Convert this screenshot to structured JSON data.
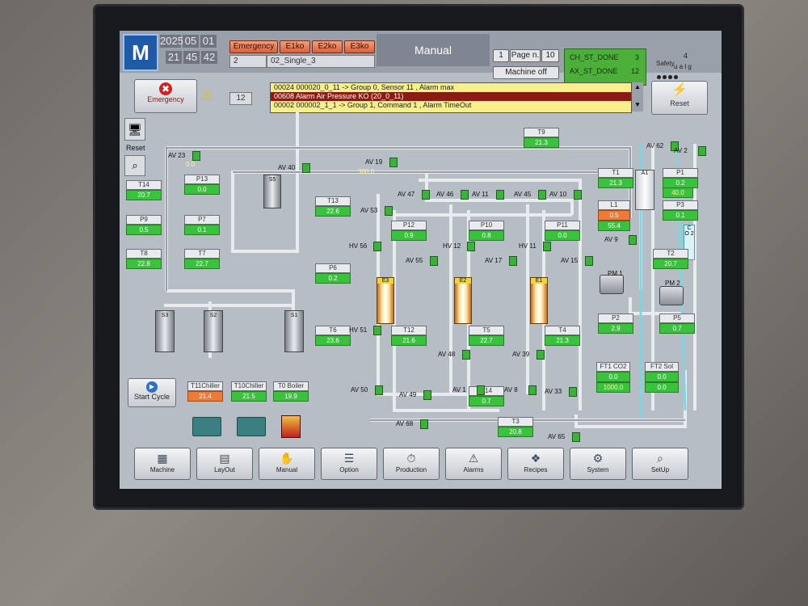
{
  "header": {
    "logo_text": "M",
    "date": [
      "2025",
      "05",
      "01"
    ],
    "time": [
      "21",
      "45",
      "42"
    ],
    "emergency_buttons": [
      "Emergency",
      "E1ko",
      "E2ko",
      "E3ko"
    ],
    "mode_num": "2",
    "recipe": "02_Single_3",
    "mode": "Manual",
    "page_label": "Page n.",
    "page_current": "1",
    "page_total": "10",
    "machine_state": "Machine off",
    "status_lines": [
      {
        "text": "CH_ST_DONE",
        "value": "3"
      },
      {
        "text": "AX_ST_DONE",
        "value": "12"
      }
    ],
    "safety_label": "Safety",
    "safety_count": "4",
    "safety_text": "u a l g"
  },
  "alarm_bar": {
    "emergency_label": "Emergency",
    "warning_count": "12",
    "reset_label": "Reset",
    "alarms": [
      {
        "text": "00024  000020_0_11 -> Group 0, Sensor 11 , Alarm max",
        "color": "#f6ef8a"
      },
      {
        "text": "00608  Alarm Air Pressure KO  (20_0_11)",
        "color": "#8a1c14"
      },
      {
        "text": "00002  000002_1_1 -> Group 1, Command 1 , Alarm TimeOut",
        "color": "#f6ef8a"
      }
    ]
  },
  "left_tools": {
    "reset_label": "Reset"
  },
  "tags": [
    {
      "id": "T9",
      "value": "21.3"
    },
    {
      "id": "T14",
      "value": "20.7"
    },
    {
      "id": "P13",
      "value": "0.0"
    },
    {
      "id": "P9",
      "value": "0.5"
    },
    {
      "id": "P7",
      "value": "0.1"
    },
    {
      "id": "T8",
      "value": "22.8"
    },
    {
      "id": "T7",
      "value": "22.7"
    },
    {
      "id": "T13",
      "value": "22.6"
    },
    {
      "id": "P6",
      "value": "0.2"
    },
    {
      "id": "T6",
      "value": "23.6"
    },
    {
      "id": "P12",
      "value": "0.9"
    },
    {
      "id": "P10",
      "value": "0.8"
    },
    {
      "id": "P11",
      "value": "0.0"
    },
    {
      "id": "T12",
      "value": "21.6"
    },
    {
      "id": "T5",
      "value": "22.7"
    },
    {
      "id": "T4",
      "value": "21.3"
    },
    {
      "id": "T1",
      "value": "21.3"
    },
    {
      "id": "P1",
      "value": "0.2"
    },
    {
      "id": "P3",
      "value": "0.1"
    },
    {
      "id": "T2",
      "value": "20.7"
    },
    {
      "id": "P2",
      "value": "2.9"
    },
    {
      "id": "P5",
      "value": "0.7"
    },
    {
      "id": "P14",
      "value": "0.7"
    },
    {
      "id": "T3",
      "value": "20.8"
    }
  ],
  "p1_sub": "40.0",
  "l1": {
    "id": "L1",
    "value": "0.5",
    "sub": "55.4"
  },
  "valves": [
    "AV 23",
    "AV 40",
    "AV 19",
    "AV 47",
    "AV 46",
    "AV 11",
    "AV 45",
    "AV 10",
    "AV 53",
    "AV 55",
    "AV 17",
    "AV 15",
    "HV 56",
    "HV 12",
    "HV 11",
    "HV 51",
    "AV 48",
    "AV 39",
    "AV 50",
    "AV 49",
    "AV 1",
    "AV 8",
    "AV 33",
    "AV 68",
    "AV 65",
    "AV 62",
    "AV 2",
    "AV 9"
  ],
  "av19_value": "300.0",
  "av23_value": "0.0",
  "vessels": [
    "S3",
    "S2",
    "S1",
    "S5"
  ],
  "reactors": [
    "E3",
    "E2",
    "E1"
  ],
  "pumps": [
    "PM 1",
    "PM 2"
  ],
  "flow": [
    {
      "id": "FT1 CO2",
      "value": "0.0",
      "sub": "1000.0"
    },
    {
      "id": "FT2 Sol",
      "value": "0.0",
      "sub": "0.0"
    }
  ],
  "co2_label": "C O 2",
  "a1_label": "A1",
  "start_cycle": "Start Cycle",
  "utilities": [
    {
      "id": "T11Chiller",
      "value": "21.4",
      "color": "orange"
    },
    {
      "id": "T10Chiller",
      "value": "21.5",
      "color": "green"
    },
    {
      "id": "T0 Boiler",
      "value": "19.9",
      "color": "green"
    }
  ],
  "nav": [
    {
      "label": "Machine",
      "icon": "machine-icon",
      "glyph": "▦"
    },
    {
      "label": "LayOut",
      "icon": "layout-icon",
      "glyph": "▤"
    },
    {
      "label": "Manual",
      "icon": "manual-icon",
      "glyph": "✋"
    },
    {
      "label": "Option",
      "icon": "option-icon",
      "glyph": "☰"
    },
    {
      "label": "Production",
      "icon": "production-icon",
      "glyph": "⏱"
    },
    {
      "label": "Alarms",
      "icon": "alarm-icon",
      "glyph": "⚠"
    },
    {
      "label": "Recipes",
      "icon": "recipes-icon",
      "glyph": "❖"
    },
    {
      "label": "System",
      "icon": "system-icon",
      "glyph": "⚙"
    },
    {
      "label": "SetUp",
      "icon": "setup-icon",
      "glyph": "⌕"
    }
  ]
}
